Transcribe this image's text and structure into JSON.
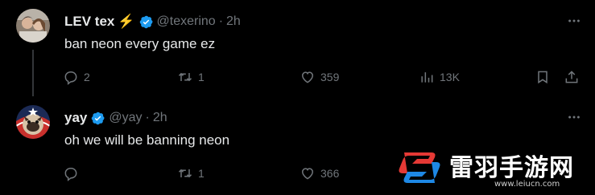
{
  "tweets": [
    {
      "display_name": "LEV tex",
      "name_emoji": "⚡",
      "handle": "@texerino",
      "separator": "·",
      "time": "2h",
      "text": "ban neon every game ez",
      "replies": "2",
      "retweets": "1",
      "likes": "359",
      "views": "13K"
    },
    {
      "display_name": "yay",
      "handle": "@yay",
      "separator": "·",
      "time": "2h",
      "text": "oh we will be banning neon",
      "replies": "",
      "retweets": "1",
      "likes": "366"
    }
  ],
  "colors": {
    "background": "#000000",
    "text": "#e7e9ea",
    "muted": "#71767b",
    "verified": "#1d9bf0",
    "thread_line": "#333639"
  },
  "icons": [
    "reply-icon",
    "retweet-icon",
    "like-icon",
    "views-icon",
    "bookmark-icon",
    "share-icon",
    "more-icon",
    "verified-badge-icon",
    "lightning-emoji"
  ],
  "watermark": {
    "title": "雷羽手游网",
    "url": "www.leiucn.com"
  }
}
